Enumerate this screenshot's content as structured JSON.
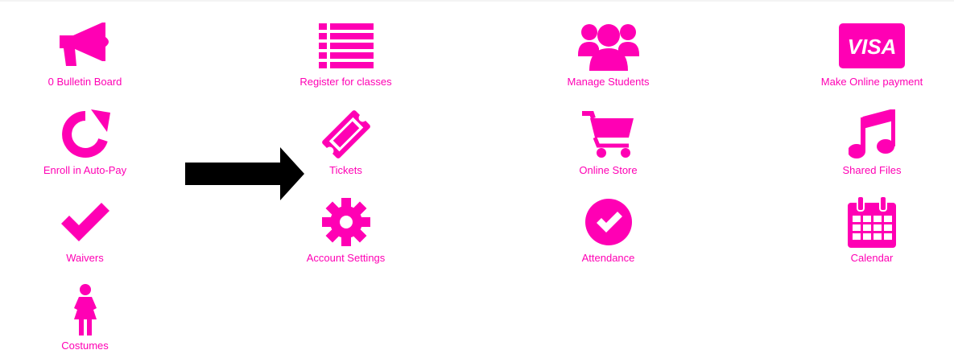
{
  "theme": {
    "accent": "#ff00b4",
    "arrow": "#000000"
  },
  "tiles": [
    {
      "label": "0 Bulletin Board",
      "icon": "megaphone-icon"
    },
    {
      "label": "Register for classes",
      "icon": "list-icon"
    },
    {
      "label": "Manage Students",
      "icon": "users-icon"
    },
    {
      "label": "Make Online payment",
      "icon": "visa-card-icon",
      "icon_text": "VISA"
    },
    {
      "label": "Enroll in Auto-Pay",
      "icon": "refresh-icon"
    },
    {
      "label": "Tickets",
      "icon": "ticket-icon"
    },
    {
      "label": "Online Store",
      "icon": "shopping-cart-icon"
    },
    {
      "label": "Shared Files",
      "icon": "music-note-icon"
    },
    {
      "label": "Waivers",
      "icon": "check-icon"
    },
    {
      "label": "Account Settings",
      "icon": "gear-icon"
    },
    {
      "label": "Attendance",
      "icon": "check-circle-icon"
    },
    {
      "label": "Calendar",
      "icon": "calendar-icon"
    },
    {
      "label": "Costumes",
      "icon": "female-figure-icon"
    }
  ],
  "pointer": {
    "icon": "right-arrow-icon",
    "target": "Tickets"
  }
}
